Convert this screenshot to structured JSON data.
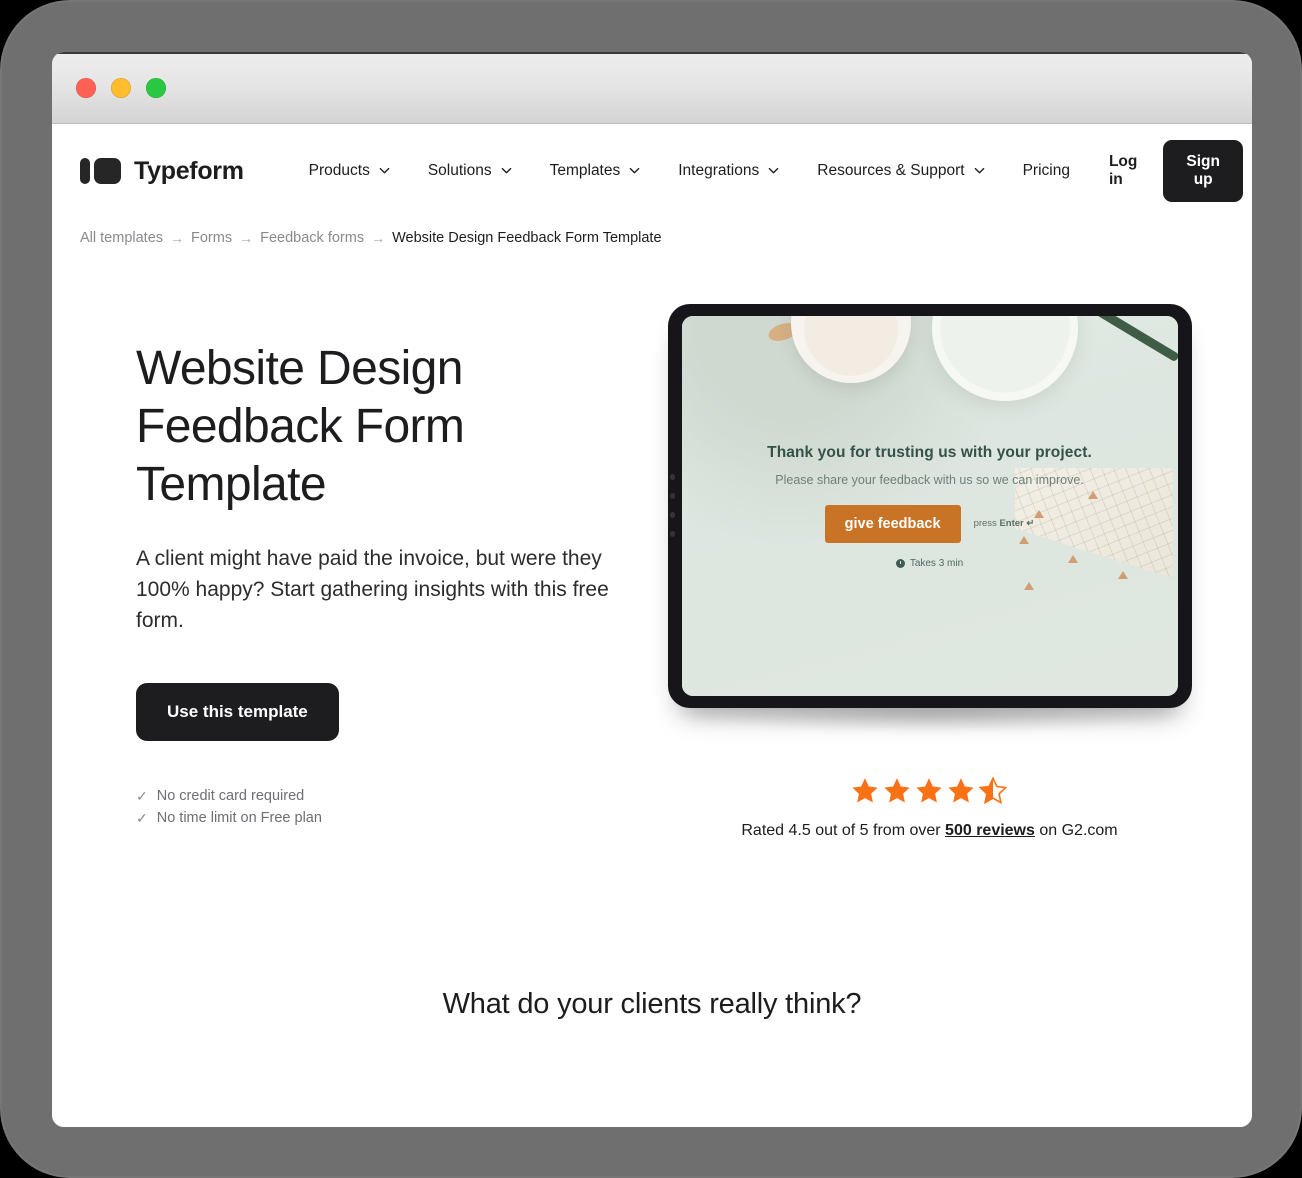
{
  "window": {
    "traffic_lights": [
      {
        "name": "close",
        "color": "#ff6157"
      },
      {
        "name": "minimize",
        "color": "#ffbd2e"
      },
      {
        "name": "maximize",
        "color": "#28c840"
      }
    ]
  },
  "nav": {
    "brand": "Typeform",
    "links": [
      {
        "label": "Products",
        "has_chevron": true
      },
      {
        "label": "Solutions",
        "has_chevron": true
      },
      {
        "label": "Templates",
        "has_chevron": true
      },
      {
        "label": "Integrations",
        "has_chevron": true
      },
      {
        "label": "Resources & Support",
        "has_chevron": true
      },
      {
        "label": "Pricing",
        "has_chevron": false
      }
    ],
    "login_label": "Log in",
    "signup_label": "Sign up"
  },
  "breadcrumb": {
    "separator": "→",
    "items": [
      {
        "label": "All templates",
        "current": false
      },
      {
        "label": "Forms",
        "current": false
      },
      {
        "label": "Feedback forms",
        "current": false
      },
      {
        "label": "Website Design Feedback Form Template",
        "current": true
      }
    ]
  },
  "hero": {
    "title": "Website Design Feedback Form Template",
    "subtitle": "A client might have paid the invoice, but were they 100% happy? Start gathering insights with this free form.",
    "cta_label": "Use this template",
    "perks": [
      {
        "check": "✓",
        "label": "No credit card required"
      },
      {
        "check": "✓",
        "label": "No time limit on Free plan"
      }
    ]
  },
  "preview": {
    "headline": "Thank you for trusting us with your project.",
    "subheadline": "Please share your feedback with us so we can improve.",
    "cta_label": "give feedback",
    "press_enter": "press ",
    "press_enter_key": "Enter ↵",
    "takes_label": "Takes 3 min",
    "accent_color": "#c97326",
    "screen_bg": "#dfe7e1"
  },
  "rating": {
    "score": 4.5,
    "out_of": 5,
    "stars_full": 4,
    "stars_half": 1,
    "star_color": "#f97316",
    "text_before": "Rated 4.5 out of 5 from over ",
    "reviews_label": "500 reviews",
    "text_after": " on G2.com"
  },
  "section": {
    "heading": "What do your clients really think?"
  }
}
